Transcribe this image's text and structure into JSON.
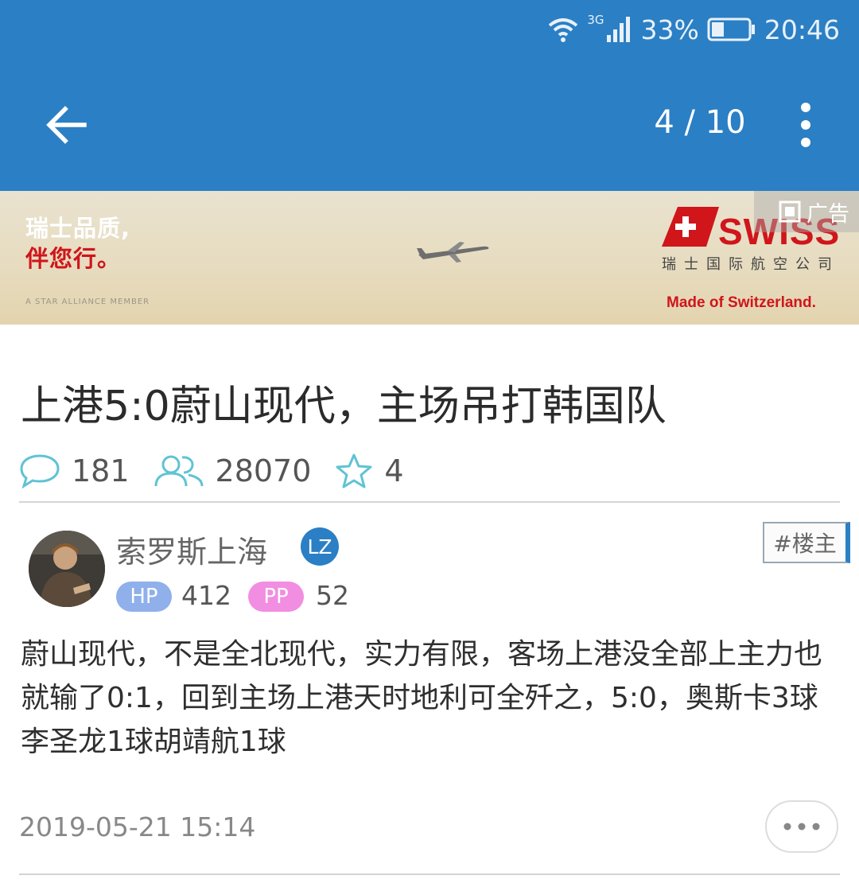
{
  "status_bar": {
    "network": "3G",
    "battery": "33%",
    "battery_level": 0.33,
    "time": "20:46"
  },
  "toolbar": {
    "page_counter": "4 / 10",
    "back_icon": "arrow-left-icon",
    "more_icon": "vertical-dots-icon"
  },
  "ad": {
    "slogan_line1": "瑞士品质,",
    "slogan_line2": "伴您行。",
    "alliance": "A STAR ALLIANCE MEMBER",
    "brand": "SWISS",
    "brand_cn": "瑞士国际航空公司",
    "tagline": "Made of Switzerland.",
    "badge": "广告",
    "colors": {
      "brand_red": "#d0151b"
    }
  },
  "post": {
    "title": "上港5:0蔚山现代，主场吊打韩国队",
    "comments": "181",
    "views": "28070",
    "favorites": "4"
  },
  "author": {
    "name": "索罗斯上海",
    "lz_badge": "LZ",
    "floor_tag": "#楼主",
    "hp_label": "HP",
    "hp_value": "412",
    "pp_label": "PP",
    "pp_value": "52"
  },
  "body": {
    "text": "蔚山现代，不是全北现代，实力有限，客场上港没全部上主力也就输了0:1，回到主场上港天时地利可全歼之，5:0，奥斯卡3球李圣龙1球胡靖航1球",
    "timestamp": "2019-05-21 15:14"
  },
  "colors": {
    "appbar": "#2b7fc4",
    "icon_teal": "#5fc3d4",
    "hp": "#8fb0ea",
    "pp": "#f28ee1"
  }
}
